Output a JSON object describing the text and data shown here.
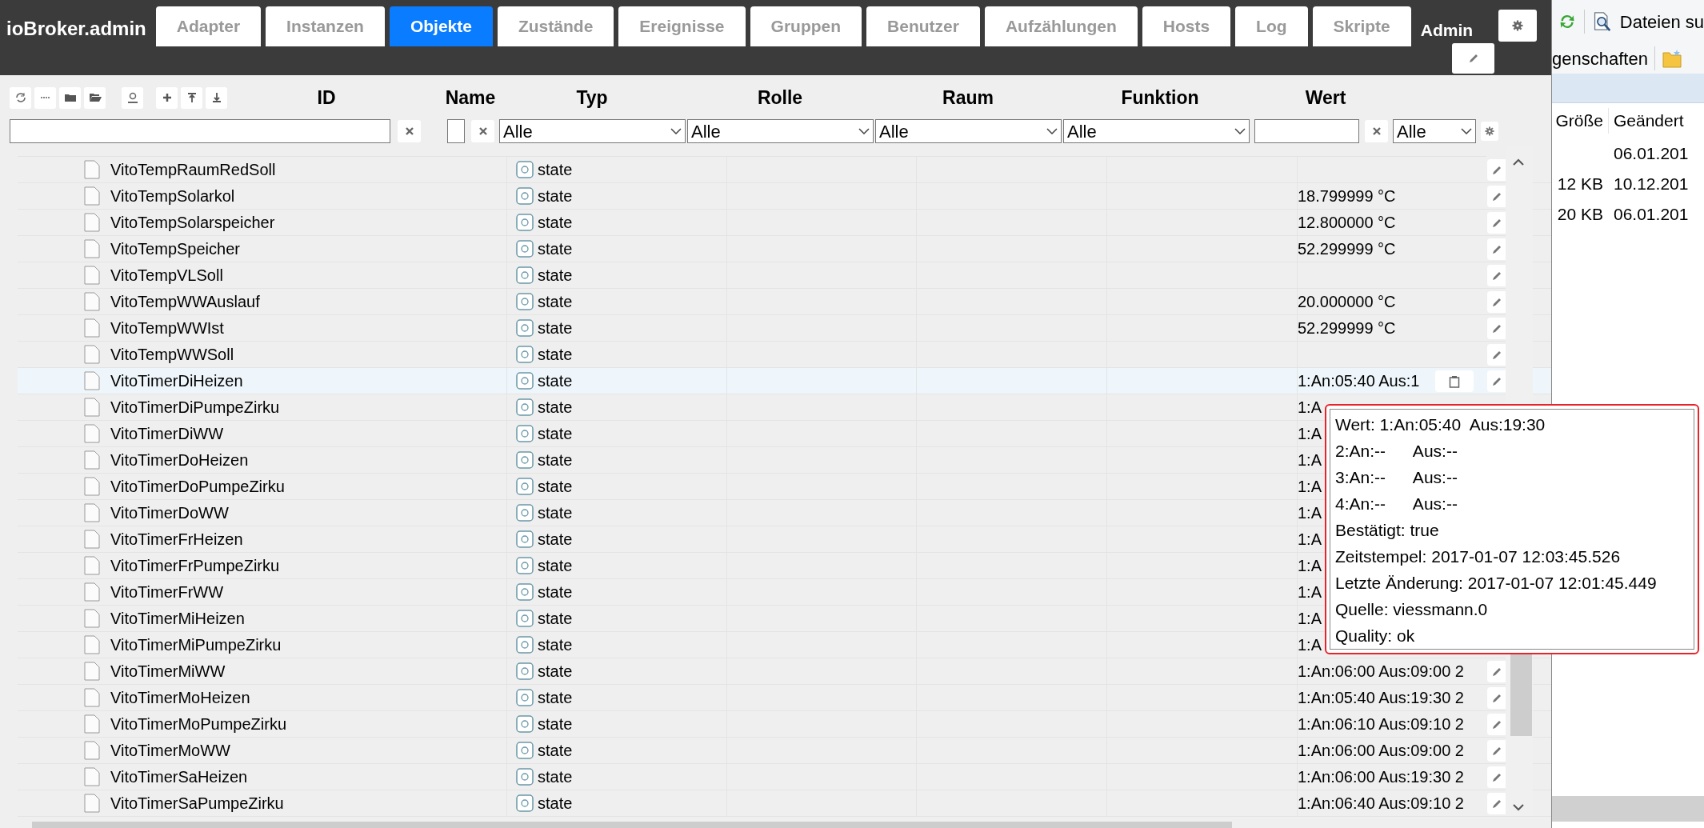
{
  "app": {
    "title": "ioBroker.admin"
  },
  "tabs": [
    {
      "label": "Adapter",
      "selected": false
    },
    {
      "label": "Instanzen",
      "selected": false
    },
    {
      "label": "Objekte",
      "selected": true
    },
    {
      "label": "Zustände",
      "selected": false
    },
    {
      "label": "Ereignisse",
      "selected": false
    },
    {
      "label": "Gruppen",
      "selected": false
    },
    {
      "label": "Benutzer",
      "selected": false
    },
    {
      "label": "Aufzählungen",
      "selected": false
    },
    {
      "label": "Hosts",
      "selected": false
    },
    {
      "label": "Log",
      "selected": false
    },
    {
      "label": "Skripte",
      "selected": false
    }
  ],
  "user": {
    "name": "Admin"
  },
  "columns": [
    "ID",
    "Name",
    "Typ",
    "Rolle",
    "Raum",
    "Funktion",
    "Wert"
  ],
  "filters": {
    "typ": "Alle",
    "rolle": "Alle",
    "raum": "Alle",
    "funktion": "Alle",
    "wert_mode": "Alle"
  },
  "rows": [
    {
      "id": "VitoTempRaumRedSoll",
      "type": "state",
      "value": "",
      "hovered": false,
      "edit": true
    },
    {
      "id": "VitoTempSolarkol",
      "type": "state",
      "value": "18.799999 °C",
      "hovered": false,
      "edit": true
    },
    {
      "id": "VitoTempSolarspeicher",
      "type": "state",
      "value": "12.800000 °C",
      "hovered": false,
      "edit": true
    },
    {
      "id": "VitoTempSpeicher",
      "type": "state",
      "value": "52.299999 °C",
      "hovered": false,
      "edit": true
    },
    {
      "id": "VitoTempVLSoll",
      "type": "state",
      "value": "",
      "hovered": false,
      "edit": true
    },
    {
      "id": "VitoTempWWAuslauf",
      "type": "state",
      "value": "20.000000 °C",
      "hovered": false,
      "edit": true
    },
    {
      "id": "VitoTempWWIst",
      "type": "state",
      "value": "52.299999 °C",
      "hovered": false,
      "edit": true
    },
    {
      "id": "VitoTempWWSoll",
      "type": "state",
      "value": "",
      "hovered": false,
      "edit": true
    },
    {
      "id": "VitoTimerDiHeizen",
      "type": "state",
      "value": "1:An:05:40 Aus:1",
      "hovered": true,
      "edit": true
    },
    {
      "id": "VitoTimerDiPumpeZirku",
      "type": "state",
      "value": "1:A",
      "hovered": false
    },
    {
      "id": "VitoTimerDiWW",
      "type": "state",
      "value": "1:A",
      "hovered": false
    },
    {
      "id": "VitoTimerDoHeizen",
      "type": "state",
      "value": "1:A",
      "hovered": false
    },
    {
      "id": "VitoTimerDoPumpeZirku",
      "type": "state",
      "value": "1:A",
      "hovered": false
    },
    {
      "id": "VitoTimerDoWW",
      "type": "state",
      "value": "1:A",
      "hovered": false
    },
    {
      "id": "VitoTimerFrHeizen",
      "type": "state",
      "value": "1:A",
      "hovered": false
    },
    {
      "id": "VitoTimerFrPumpeZirku",
      "type": "state",
      "value": "1:A",
      "hovered": false
    },
    {
      "id": "VitoTimerFrWW",
      "type": "state",
      "value": "1:A",
      "hovered": false
    },
    {
      "id": "VitoTimerMiHeizen",
      "type": "state",
      "value": "1:A",
      "hovered": false
    },
    {
      "id": "VitoTimerMiPumpeZirku",
      "type": "state",
      "value": "1:A",
      "hovered": false
    },
    {
      "id": "VitoTimerMiWW",
      "type": "state",
      "value": "1:An:06:00 Aus:09:00 2",
      "hovered": false,
      "edit": true
    },
    {
      "id": "VitoTimerMoHeizen",
      "type": "state",
      "value": "1:An:05:40 Aus:19:30 2",
      "hovered": false,
      "edit": true
    },
    {
      "id": "VitoTimerMoPumpeZirku",
      "type": "state",
      "value": "1:An:06:10 Aus:09:10 2",
      "hovered": false,
      "edit": true
    },
    {
      "id": "VitoTimerMoWW",
      "type": "state",
      "value": "1:An:06:00 Aus:09:00 2",
      "hovered": false,
      "edit": true
    },
    {
      "id": "VitoTimerSaHeizen",
      "type": "state",
      "value": "1:An:06:00 Aus:19:30 2",
      "hovered": false,
      "edit": true
    },
    {
      "id": "VitoTimerSaPumpeZirku",
      "type": "state",
      "value": "1:An:06:40 Aus:09:10 2",
      "hovered": false,
      "edit": true
    }
  ],
  "tooltip": {
    "lines": [
      "Wert: 1:An:05:40  Aus:19:30",
      "2:An:--      Aus:--",
      "3:An:--      Aus:--",
      "4:An:--      Aus:--",
      "Bestätigt: true",
      "Zeitstempel: 2017-01-07 12:03:45.526",
      "Letzte Änderung: 2017-01-07 12:01:45.449",
      "Quelle: viessmann.0",
      "Quality: ok"
    ]
  },
  "explorer": {
    "search_label": "Dateien su",
    "properties_label": "genschaften",
    "columns": [
      "Größe",
      "Geändert"
    ],
    "rows": [
      {
        "size": "",
        "changed": "06.01.201"
      },
      {
        "size": "12 KB",
        "changed": "10.12.201"
      },
      {
        "size": "20 KB",
        "changed": "06.01.201"
      }
    ]
  }
}
